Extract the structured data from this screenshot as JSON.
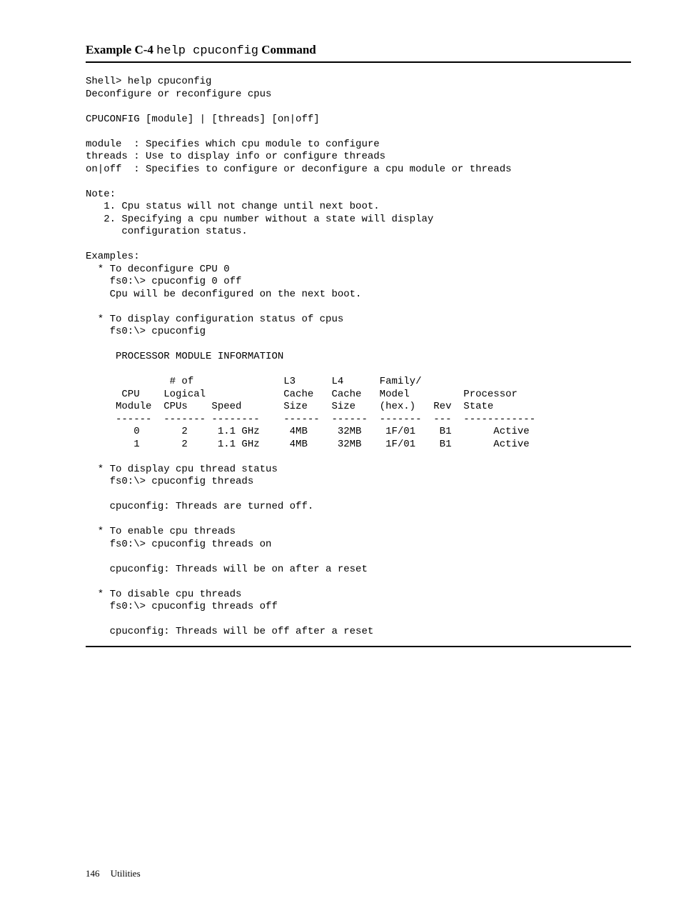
{
  "heading": {
    "prefix": "Example C-4",
    "command": "help cpuconfig",
    "suffix": "Command"
  },
  "codeblock": "Shell> help cpuconfig\nDeconfigure or reconfigure cpus\n\nCPUCONFIG [module] | [threads] [on|off]\n\nmodule  : Specifies which cpu module to configure\nthreads : Use to display info or configure threads\non|off  : Specifies to configure or deconfigure a cpu module or threads\n\nNote:\n   1. Cpu status will not change until next boot.\n   2. Specifying a cpu number without a state will display\n      configuration status.\n\nExamples:\n  * To deconfigure CPU 0\n    fs0:\\> cpuconfig 0 off\n    Cpu will be deconfigured on the next boot.\n\n  * To display configuration status of cpus\n    fs0:\\> cpuconfig\n\n     PROCESSOR MODULE INFORMATION\n\n              # of               L3      L4      Family/\n      CPU    Logical             Cache   Cache   Model         Processor\n     Module  CPUs    Speed       Size    Size    (hex.)   Rev  State\n     ------  ------- --------    ------  ------  -------  ---  ------------\n        0       2     1.1 GHz     4MB     32MB    1F/01    B1       Active\n        1       2     1.1 GHz     4MB     32MB    1F/01    B1       Active\n\n  * To display cpu thread status\n    fs0:\\> cpuconfig threads\n\n    cpuconfig: Threads are turned off.\n\n  * To enable cpu threads\n    fs0:\\> cpuconfig threads on\n\n    cpuconfig: Threads will be on after a reset\n\n  * To disable cpu threads\n    fs0:\\> cpuconfig threads off\n\n    cpuconfig: Threads will be off after a reset",
  "footer": {
    "pagenum": "146",
    "section": "Utilities"
  }
}
